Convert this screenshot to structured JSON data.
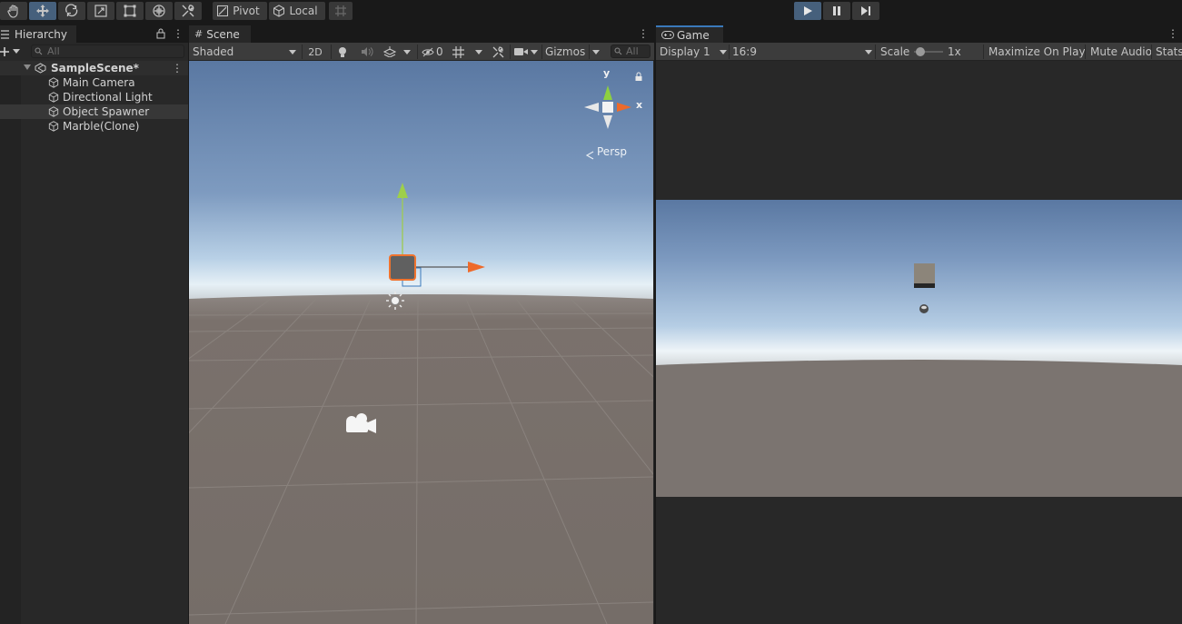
{
  "toolbar": {
    "tools": [
      "hand-tool",
      "move-tool",
      "rotate-tool",
      "scale-tool",
      "rect-tool",
      "transform-tool",
      "custom-tool"
    ],
    "pivot_label": "Pivot",
    "local_label": "Local"
  },
  "hierarchy": {
    "tab_label": "Hierarchy",
    "search_placeholder": "All",
    "scene_name": "SampleScene*",
    "items": [
      {
        "label": "Main Camera"
      },
      {
        "label": "Directional Light"
      },
      {
        "label": "Object Spawner",
        "selected": true
      },
      {
        "label": "Marble(Clone)"
      }
    ]
  },
  "scene": {
    "tab_label": "Scene",
    "shading_mode": "Shaded",
    "mode_2d_label": "2D",
    "hidden_count": "0",
    "gizmos_label": "Gizmos",
    "search_placeholder": "All",
    "axis_y": "y",
    "axis_x": "x",
    "persp_label": "Persp"
  },
  "game": {
    "tab_label": "Game",
    "display_label": "Display 1",
    "aspect_label": "16:9",
    "scale_label": "Scale",
    "scale_value": "1x",
    "maximize_label": "Maximize On Play",
    "mute_label": "Mute Audio",
    "stats_label": "Stats"
  },
  "colors": {
    "play_active": "#46607c",
    "accent_tab": "#3a79bb",
    "selection_outline": "#f0732e"
  }
}
